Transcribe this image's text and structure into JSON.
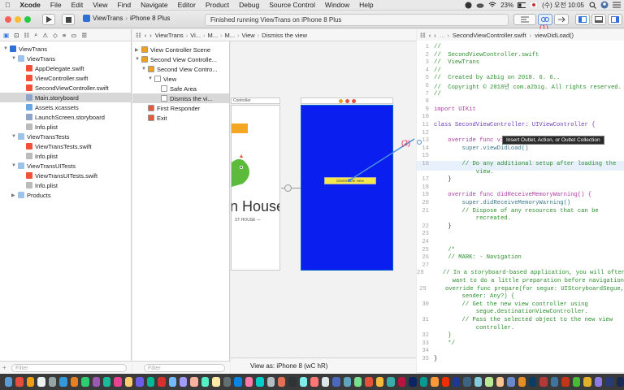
{
  "menubar": {
    "app": "Xcode",
    "items": [
      "File",
      "Edit",
      "View",
      "Find",
      "Navigate",
      "Editor",
      "Product",
      "Debug",
      "Source Control",
      "Window",
      "Help"
    ],
    "battery": "23%",
    "clock": "(수) 오전 10:05"
  },
  "toolbar": {
    "scheme": "ViewTrans",
    "device": "iPhone 8 Plus",
    "activity": "Finished running ViewTrans on iPhone 8 Plus",
    "annotation1": "(1)"
  },
  "navigator": {
    "items": [
      {
        "label": "ViewTrans",
        "indent": 0,
        "icon": "proj",
        "tri": "▼"
      },
      {
        "label": "ViewTrans",
        "indent": 1,
        "icon": "folder",
        "tri": "▼"
      },
      {
        "label": "AppDelegate.swift",
        "indent": 2,
        "icon": "swift",
        "tri": ""
      },
      {
        "label": "ViewController.swift",
        "indent": 2,
        "icon": "swift",
        "tri": ""
      },
      {
        "label": "SecondViewController.swift",
        "indent": 2,
        "icon": "swift",
        "tri": ""
      },
      {
        "label": "Main.storyboard",
        "indent": 2,
        "icon": "sb",
        "tri": "",
        "selected": true
      },
      {
        "label": "Assets.xcassets",
        "indent": 2,
        "icon": "xc",
        "tri": ""
      },
      {
        "label": "LaunchScreen.storyboard",
        "indent": 2,
        "icon": "sb",
        "tri": ""
      },
      {
        "label": "Info.plist",
        "indent": 2,
        "icon": "plist",
        "tri": ""
      },
      {
        "label": "ViewTransTests",
        "indent": 1,
        "icon": "folder",
        "tri": "▼"
      },
      {
        "label": "ViewTransTests.swift",
        "indent": 2,
        "icon": "swift",
        "tri": ""
      },
      {
        "label": "Info.plist",
        "indent": 2,
        "icon": "plist",
        "tri": ""
      },
      {
        "label": "ViewTransUITests",
        "indent": 1,
        "icon": "folder",
        "tri": "▼"
      },
      {
        "label": "ViewTransUITests.swift",
        "indent": 2,
        "icon": "swift",
        "tri": ""
      },
      {
        "label": "Info.plist",
        "indent": 2,
        "icon": "plist",
        "tri": ""
      },
      {
        "label": "Products",
        "indent": 1,
        "icon": "folder",
        "tri": "▶"
      }
    ],
    "filter_placeholder": "Filter"
  },
  "ib_jumpbar": [
    "ViewTrans",
    "Vi...",
    "M...",
    "M...",
    "View",
    "Dismiss the view"
  ],
  "outline": {
    "items": [
      {
        "label": "View Controller Scene",
        "indent": 0,
        "tri": "▶",
        "icon": "#f0a020"
      },
      {
        "label": "Second View Controlle...",
        "indent": 0,
        "tri": "▼",
        "icon": "#f0a020"
      },
      {
        "label": "Second View Contro...",
        "indent": 1,
        "tri": "▼",
        "icon": "#f0a020"
      },
      {
        "label": "View",
        "indent": 2,
        "tri": "▼",
        "icon": "#ffffff"
      },
      {
        "label": "Safe Area",
        "indent": 3,
        "tri": "",
        "icon": "#ffffff"
      },
      {
        "label": "Dismiss the vi...",
        "indent": 3,
        "tri": "",
        "icon": "#ffffff",
        "selected": true
      },
      {
        "label": "First Responder",
        "indent": 1,
        "tri": "",
        "icon": "#e55a3c"
      },
      {
        "label": "Exit",
        "indent": 1,
        "tri": "",
        "icon": "#e55a3c"
      }
    ],
    "filter_placeholder": "Filter"
  },
  "canvas": {
    "scene1_title": "Controller",
    "scene1_brand": "n House",
    "scene1_tagline": "ST HOUSE —",
    "button_label": "Dismiss the view",
    "view_as": "View as: iPhone 8 (wC hR)",
    "annotation2": "(2)",
    "tooltip": "Insert Outlet, Action, or Outlet Collection"
  },
  "editor": {
    "jumpbar_file": "SecondViewController.swift",
    "jumpbar_symbol": "viewDidLoad()",
    "lines": [
      {
        "n": "1",
        "t": "//",
        "c": "cm"
      },
      {
        "n": "2",
        "t": "//  SecondViewController.swift",
        "c": "cm"
      },
      {
        "n": "3",
        "t": "//  ViewTrans",
        "c": "cm"
      },
      {
        "n": "4",
        "t": "//",
        "c": "cm"
      },
      {
        "n": "5",
        "t": "//  Created by a2big on 2018. 6. 6..",
        "c": "cm"
      },
      {
        "n": "6",
        "t": "//  Copyright © 2018년 com.a2big. All rights reserved.",
        "c": "cm"
      },
      {
        "n": "7",
        "t": "//",
        "c": "cm"
      },
      {
        "n": "8",
        "t": "",
        "c": ""
      },
      {
        "n": "9",
        "t": "import UIKit",
        "c": "kw"
      },
      {
        "n": "10",
        "t": "",
        "c": ""
      },
      {
        "n": "11",
        "t": "class SecondViewController: UIViewController {",
        "c": "ty"
      },
      {
        "n": "12",
        "t": "",
        "c": ""
      },
      {
        "n": "13",
        "t": "    override func vie",
        "c": "kw"
      },
      {
        "n": "14",
        "t": "        super.viewDidLoad()",
        "c": "fn"
      },
      {
        "n": "15",
        "t": "",
        "c": ""
      },
      {
        "n": "16",
        "t": "        // Do any additional setup after loading the",
        "c": "cm"
      },
      {
        "n": "",
        "t": "            view.",
        "c": "cm"
      },
      {
        "n": "17",
        "t": "    }",
        "c": ""
      },
      {
        "n": "18",
        "t": "",
        "c": ""
      },
      {
        "n": "19",
        "t": "    override func didReceiveMemoryWarning() {",
        "c": "kw"
      },
      {
        "n": "20",
        "t": "        super.didReceiveMemoryWarning()",
        "c": "fn"
      },
      {
        "n": "21",
        "t": "        // Dispose of any resources that can be",
        "c": "cm"
      },
      {
        "n": "",
        "t": "            recreated.",
        "c": "cm"
      },
      {
        "n": "22",
        "t": "    }",
        "c": ""
      },
      {
        "n": "23",
        "t": "",
        "c": ""
      },
      {
        "n": "24",
        "t": "",
        "c": ""
      },
      {
        "n": "25",
        "t": "    /*",
        "c": "cm"
      },
      {
        "n": "26",
        "t": "    // MARK: - Navigation",
        "c": "cm"
      },
      {
        "n": "27",
        "t": "",
        "c": ""
      },
      {
        "n": "28",
        "t": "    // In a storyboard-based application, you will often",
        "c": "cm"
      },
      {
        "n": "",
        "t": "        want to do a little preparation before navigation",
        "c": "cm"
      },
      {
        "n": "29",
        "t": "    override func prepare(for segue: UIStoryboardSegue,",
        "c": "cm"
      },
      {
        "n": "",
        "t": "        sender: Any?) {",
        "c": "cm"
      },
      {
        "n": "30",
        "t": "        // Get the new view controller using",
        "c": "cm"
      },
      {
        "n": "",
        "t": "            segue.destinationViewController.",
        "c": "cm"
      },
      {
        "n": "31",
        "t": "        // Pass the selected object to the new view",
        "c": "cm"
      },
      {
        "n": "",
        "t": "            controller.",
        "c": "cm"
      },
      {
        "n": "32",
        "t": "    }",
        "c": "cm"
      },
      {
        "n": "33",
        "t": "    */",
        "c": "cm"
      },
      {
        "n": "34",
        "t": "",
        "c": ""
      },
      {
        "n": "35",
        "t": "}",
        "c": ""
      }
    ]
  },
  "dock_colors": [
    "#5a9bd5",
    "#e74c3c",
    "#f39c12",
    "#ecf0f1",
    "#95a5a6",
    "#3498db",
    "#e67e22",
    "#2ecc71",
    "#9b59b6",
    "#1abc9c",
    "#e84393",
    "#fdcb6e",
    "#6c5ce7",
    "#00b894",
    "#d63031",
    "#74b9ff",
    "#a29bfe",
    "#fab1a0",
    "#55efc4",
    "#ffeaa7",
    "#636e72",
    "#0984e3",
    "#fd79a8",
    "#00cec9",
    "#b2bec3",
    "#e17055",
    "#2d3436",
    "#81ecec",
    "#ff7675",
    "#dfe6e9",
    "#4a69bd",
    "#60a3bc",
    "#78e08f",
    "#e55039",
    "#f6b93b",
    "#38ada9",
    "#b71540",
    "#0c2461",
    "#079992",
    "#fa983a",
    "#eb2f06",
    "#1e3799",
    "#3c6382",
    "#82ccdd",
    "#b8e994",
    "#f8c291",
    "#6a89cc",
    "#e58e26",
    "#0a3d62",
    "#b33939",
    "#40739e",
    "#c23616",
    "#44bd32",
    "#e1b12c",
    "#8c7ae6",
    "#273c75",
    "#192a56"
  ]
}
